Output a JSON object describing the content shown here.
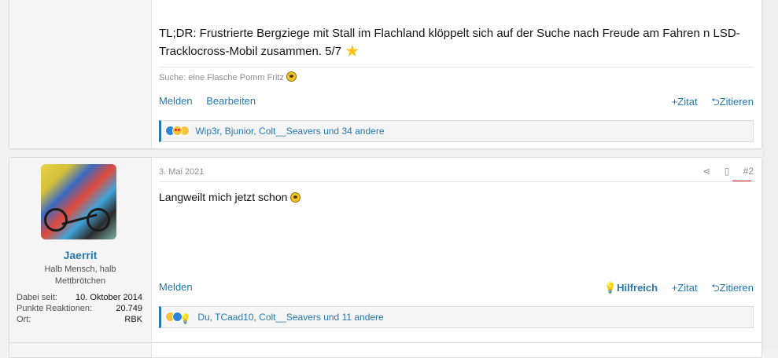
{
  "post1": {
    "body": "TL;DR: Frustrierte Bergziege mit Stall im Flachland klöppelt sich auf der Suche nach Freude am Fahren n LSD-Tracklocross-Mobil zusammen. 5/7",
    "signature": "Suche: eine Flasche Pomm Fritz",
    "actions": {
      "report": "Melden",
      "edit": "Bearbeiten",
      "quote": "Zitat",
      "reply": "Zitieren"
    },
    "reactions": "Wip3r, Bjunior, Colt__Seavers und 34 andere"
  },
  "post2": {
    "user": {
      "name": "Jaerrit",
      "title": "Halb Mensch, halb Mettbrötchen",
      "info": [
        {
          "label": "Dabei seit:",
          "value": "10. Oktober 2014"
        },
        {
          "label": "Punkte Reaktionen:",
          "value": "20.749"
        },
        {
          "label": "Ort:",
          "value": "RBK"
        }
      ]
    },
    "date": "3. Mai 2021",
    "number": "#2",
    "body": "Langweilt mich jetzt schon",
    "actions": {
      "report": "Melden",
      "helpful": "Hilfreich",
      "quote": "Zitat",
      "reply": "Zitieren"
    },
    "reactions": "Du, TCaad10, Colt__Seavers und 11 andere"
  }
}
